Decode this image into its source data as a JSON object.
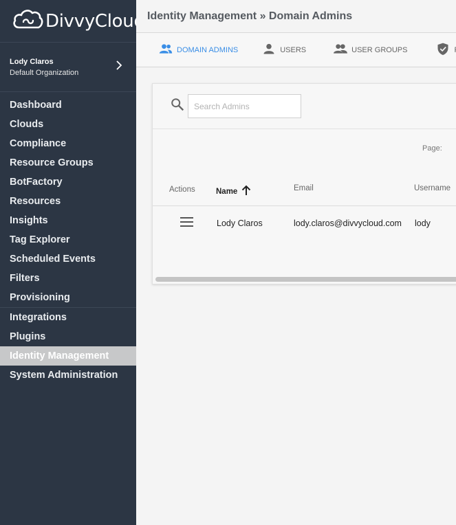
{
  "sidebar": {
    "logo_text": "DivvyCloud",
    "user": {
      "name": "Lody Claros",
      "organization": "Default Organization"
    },
    "items": [
      {
        "label": "Dashboard"
      },
      {
        "label": "Clouds"
      },
      {
        "label": "Compliance"
      },
      {
        "label": "Resource Groups"
      },
      {
        "label": "BotFactory"
      },
      {
        "label": "Resources"
      },
      {
        "label": "Insights"
      },
      {
        "label": "Tag Explorer"
      },
      {
        "label": "Scheduled Events"
      },
      {
        "label": "Filters"
      },
      {
        "label": "Provisioning"
      },
      {
        "label": "Integrations"
      },
      {
        "label": "Plugins"
      },
      {
        "label": "Identity Management"
      },
      {
        "label": "System Administration"
      }
    ],
    "active_item": "Identity Management"
  },
  "header": {
    "title": "Identity Management » Domain Admins"
  },
  "tabs": [
    {
      "label": "DOMAIN ADMINS",
      "icon": "domain-admins-icon",
      "active": true
    },
    {
      "label": "USERS",
      "icon": "user-icon",
      "active": false
    },
    {
      "label": "USER GROUPS",
      "icon": "user-groups-icon",
      "active": false
    },
    {
      "label": "RO",
      "icon": "shield-icon",
      "active": false
    }
  ],
  "search": {
    "placeholder": "Search Admins",
    "value": ""
  },
  "pagination": {
    "label": "Page:"
  },
  "table": {
    "columns": [
      "Actions",
      "Name",
      "Email",
      "Username"
    ],
    "sort": {
      "column": "Name",
      "direction": "ascending"
    },
    "rows": [
      {
        "name": "Lody Claros",
        "email": "lody.claros@divvycloud.com",
        "username": "lody"
      }
    ]
  },
  "colors": {
    "sidebar_bg": "#2c3644",
    "accent": "#3a8ee6",
    "active_item_bg": "#c7c8c9"
  }
}
